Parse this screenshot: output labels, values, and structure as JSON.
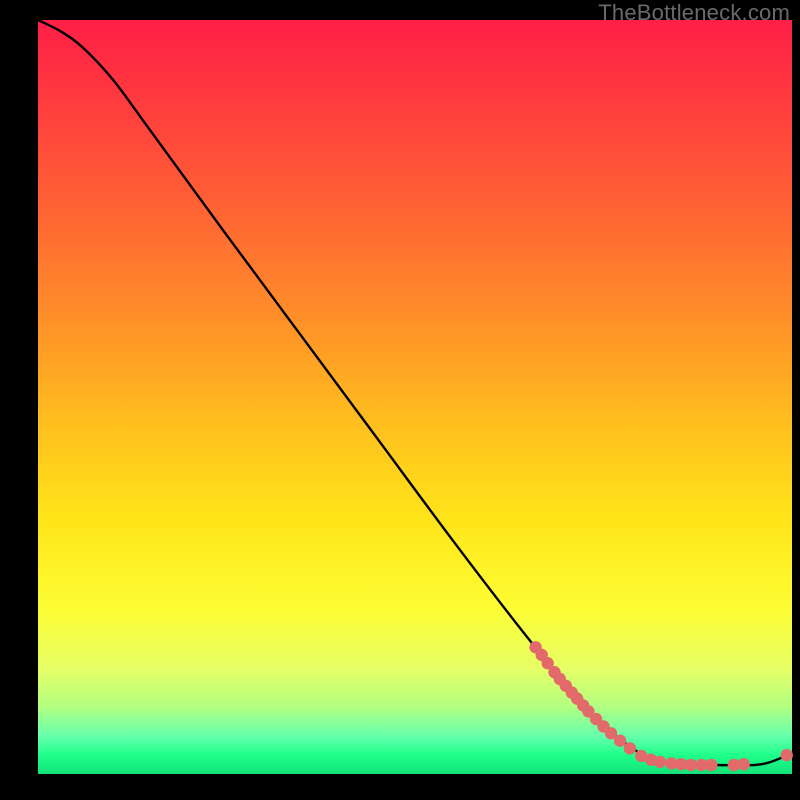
{
  "watermark": "TheBottleneck.com",
  "colors": {
    "dot": "#e26a6a",
    "curve": "#000000"
  },
  "chart_data": {
    "type": "line",
    "title": "",
    "xlabel": "",
    "ylabel": "",
    "xlim": [
      0,
      100
    ],
    "ylim": [
      0,
      100
    ],
    "grid": false,
    "legend": false,
    "note": "Axes are unlabeled in the source image. x/y expressed as 0–100 percent of plot width/height (y=0 at bottom).",
    "curve_points": [
      {
        "x": 0.0,
        "y": 100.0
      },
      {
        "x": 3.0,
        "y": 98.5
      },
      {
        "x": 6.0,
        "y": 96.3
      },
      {
        "x": 10.0,
        "y": 92.0
      },
      {
        "x": 15.0,
        "y": 85.2
      },
      {
        "x": 25.0,
        "y": 71.5
      },
      {
        "x": 35.0,
        "y": 58.0
      },
      {
        "x": 45.0,
        "y": 44.5
      },
      {
        "x": 55.0,
        "y": 31.0
      },
      {
        "x": 65.0,
        "y": 18.0
      },
      {
        "x": 72.0,
        "y": 9.5
      },
      {
        "x": 78.0,
        "y": 4.0
      },
      {
        "x": 83.0,
        "y": 1.5
      },
      {
        "x": 90.0,
        "y": 1.2
      },
      {
        "x": 96.0,
        "y": 1.3
      },
      {
        "x": 100.0,
        "y": 2.8
      }
    ],
    "scatter_points": [
      {
        "x": 66.0,
        "y": 16.8
      },
      {
        "x": 66.8,
        "y": 15.8
      },
      {
        "x": 67.6,
        "y": 14.7
      },
      {
        "x": 68.5,
        "y": 13.5
      },
      {
        "x": 69.2,
        "y": 12.6
      },
      {
        "x": 70.0,
        "y": 11.7
      },
      {
        "x": 70.8,
        "y": 10.8
      },
      {
        "x": 71.5,
        "y": 10.0
      },
      {
        "x": 72.3,
        "y": 9.1
      },
      {
        "x": 73.0,
        "y": 8.3
      },
      {
        "x": 74.0,
        "y": 7.3
      },
      {
        "x": 75.0,
        "y": 6.3
      },
      {
        "x": 76.0,
        "y": 5.4
      },
      {
        "x": 77.2,
        "y": 4.4
      },
      {
        "x": 78.5,
        "y": 3.4
      },
      {
        "x": 80.0,
        "y": 2.4
      },
      {
        "x": 81.3,
        "y": 1.9
      },
      {
        "x": 82.5,
        "y": 1.6
      },
      {
        "x": 84.0,
        "y": 1.4
      },
      {
        "x": 85.3,
        "y": 1.3
      },
      {
        "x": 86.6,
        "y": 1.2
      },
      {
        "x": 88.0,
        "y": 1.2
      },
      {
        "x": 89.3,
        "y": 1.2
      },
      {
        "x": 92.3,
        "y": 1.2
      },
      {
        "x": 93.6,
        "y": 1.3
      },
      {
        "x": 99.3,
        "y": 2.5
      }
    ]
  }
}
